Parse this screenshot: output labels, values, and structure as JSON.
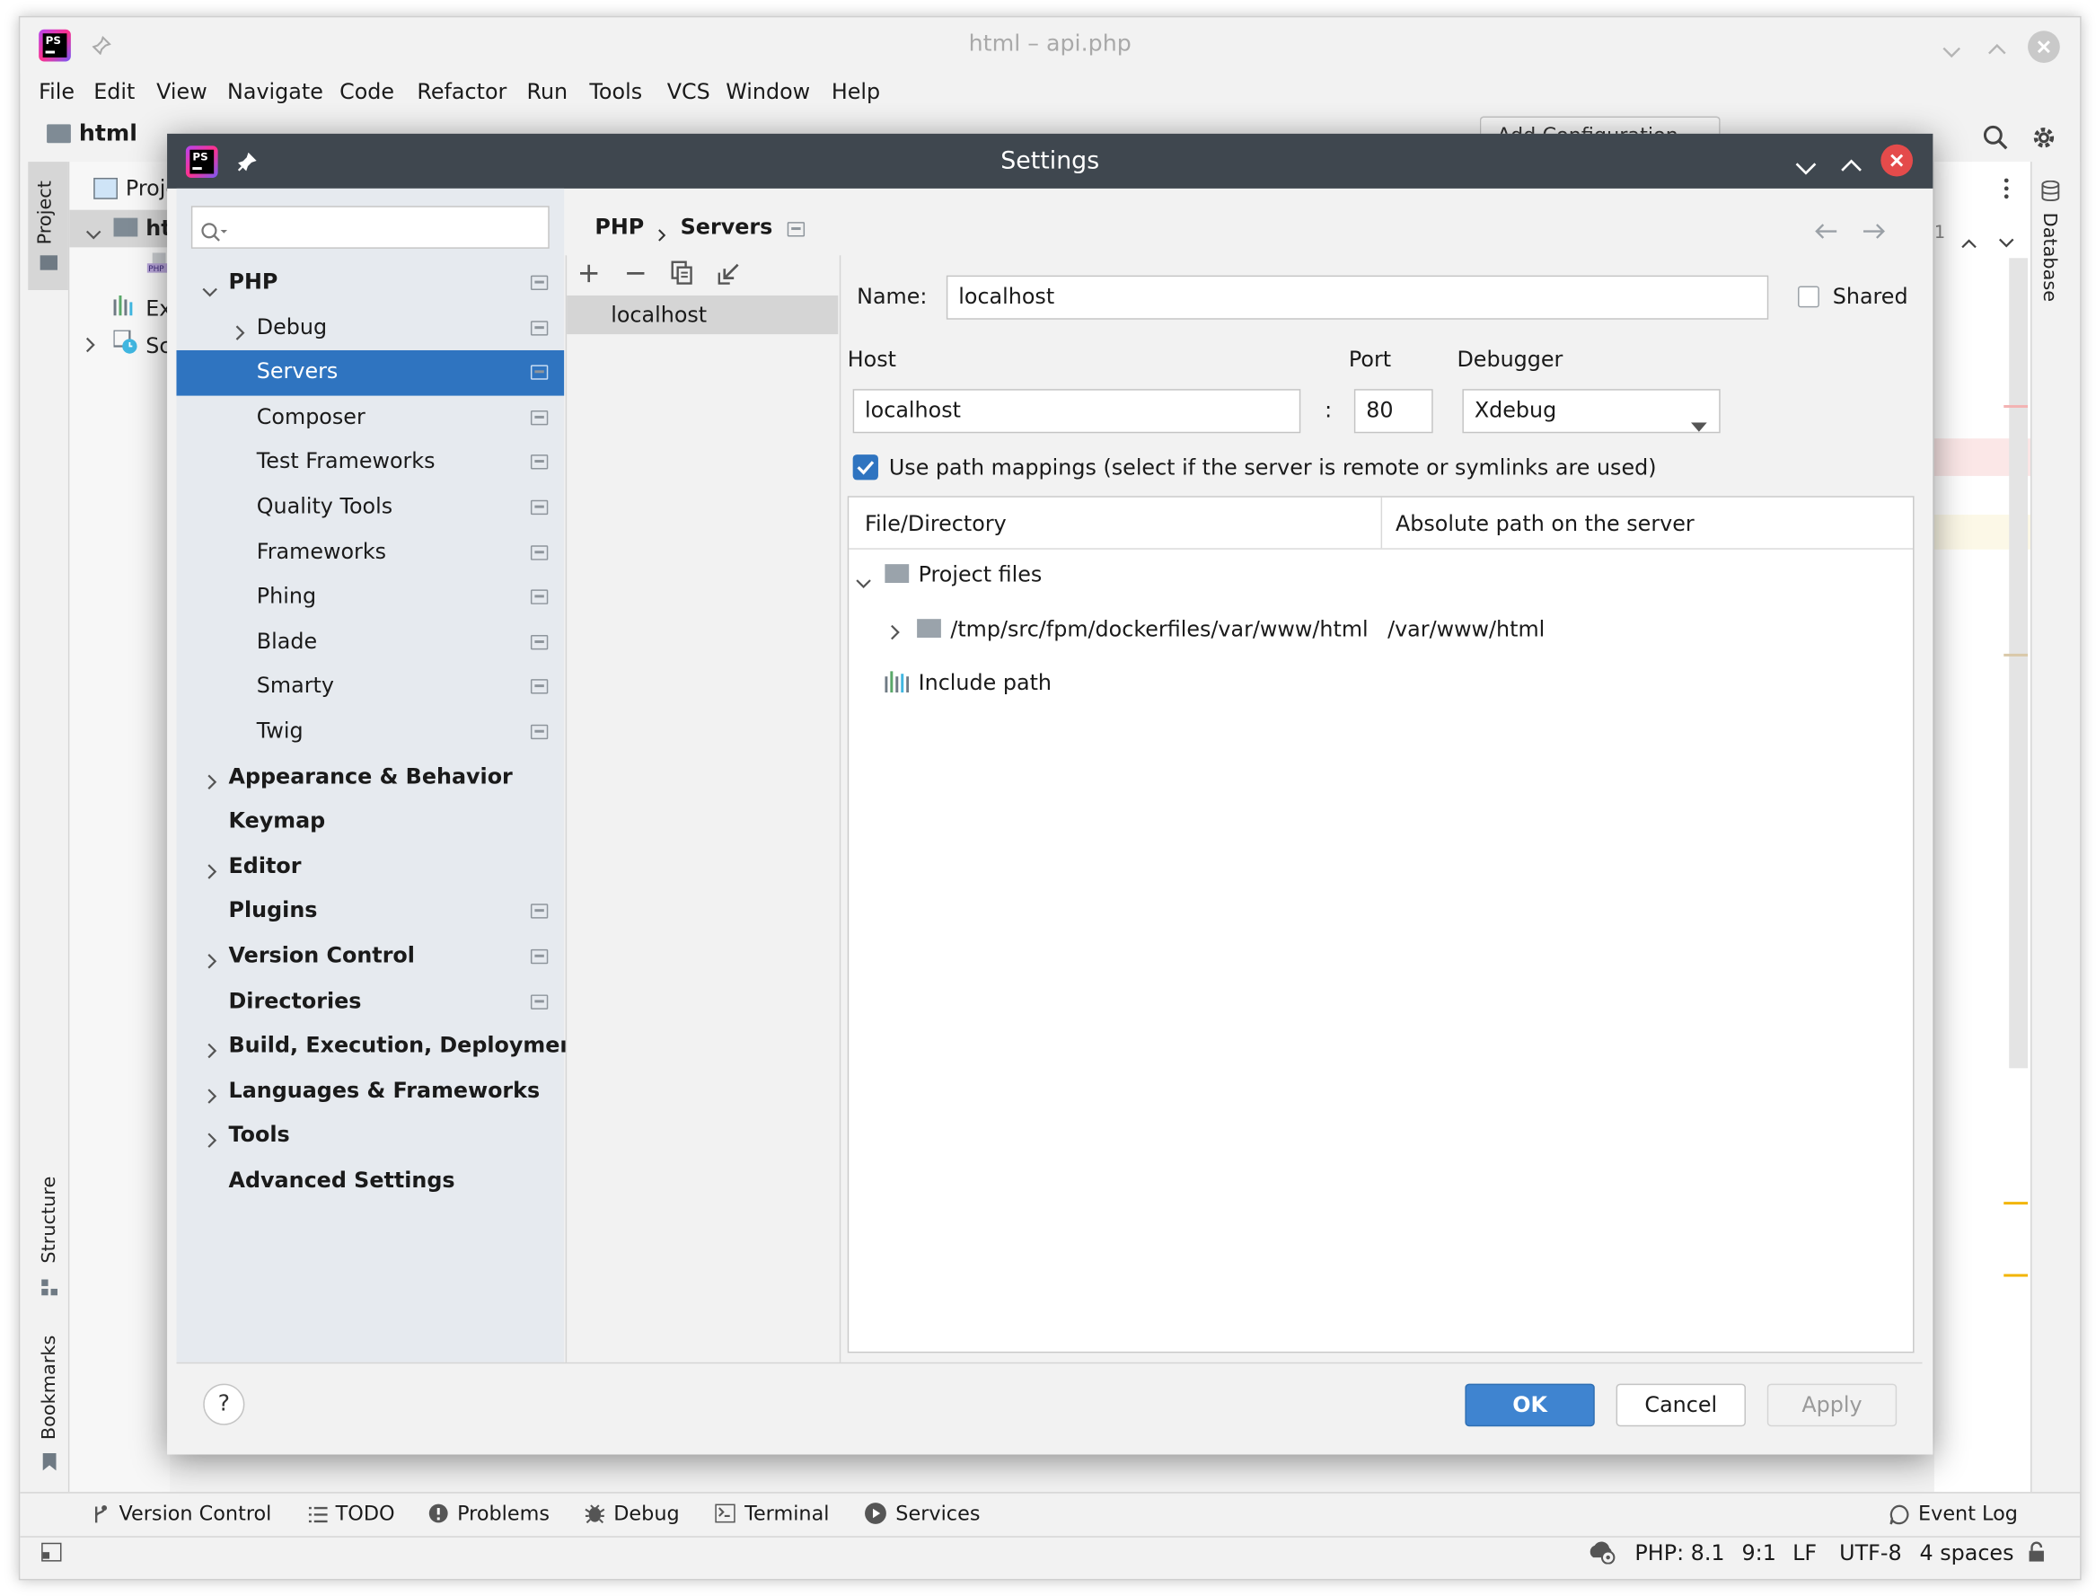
{
  "window": {
    "title": "html – api.php"
  },
  "menu": [
    "File",
    "Edit",
    "View",
    "Navigate",
    "Code",
    "Refactor",
    "Run",
    "Tools",
    "VCS",
    "Window",
    "Help"
  ],
  "navbar": {
    "project": "html",
    "run_config": "Add Configuration..."
  },
  "project_panel": {
    "header": "Proje",
    "rows": [
      "ht",
      "Ex",
      "Sc"
    ]
  },
  "left_tool_tabs": [
    "Project",
    "Structure",
    "Bookmarks"
  ],
  "right_tool_tabs": [
    "Database"
  ],
  "dialog": {
    "title": "Settings",
    "search": {
      "value": "",
      "placeholder": ""
    },
    "tree": [
      {
        "label": "PHP",
        "bold": true,
        "chevron": "down",
        "level": 0,
        "settings": true
      },
      {
        "label": "Debug",
        "bold": false,
        "chevron": "right",
        "level": 1,
        "settings": true
      },
      {
        "label": "Servers",
        "bold": false,
        "chevron": "",
        "level": 1,
        "settings": true,
        "selected": true
      },
      {
        "label": "Composer",
        "bold": false,
        "chevron": "",
        "level": 1,
        "settings": true
      },
      {
        "label": "Test Frameworks",
        "bold": false,
        "chevron": "",
        "level": 1,
        "settings": true
      },
      {
        "label": "Quality Tools",
        "bold": false,
        "chevron": "",
        "level": 1,
        "settings": true
      },
      {
        "label": "Frameworks",
        "bold": false,
        "chevron": "",
        "level": 1,
        "settings": true
      },
      {
        "label": "Phing",
        "bold": false,
        "chevron": "",
        "level": 1,
        "settings": true
      },
      {
        "label": "Blade",
        "bold": false,
        "chevron": "",
        "level": 1,
        "settings": true
      },
      {
        "label": "Smarty",
        "bold": false,
        "chevron": "",
        "level": 1,
        "settings": true
      },
      {
        "label": "Twig",
        "bold": false,
        "chevron": "",
        "level": 1,
        "settings": true
      },
      {
        "label": "Appearance & Behavior",
        "bold": true,
        "chevron": "right",
        "level": 0,
        "settings": false
      },
      {
        "label": "Keymap",
        "bold": true,
        "chevron": "",
        "level": 0,
        "settings": false
      },
      {
        "label": "Editor",
        "bold": true,
        "chevron": "right",
        "level": 0,
        "settings": false
      },
      {
        "label": "Plugins",
        "bold": true,
        "chevron": "",
        "level": 0,
        "settings": true
      },
      {
        "label": "Version Control",
        "bold": true,
        "chevron": "right",
        "level": 0,
        "settings": true
      },
      {
        "label": "Directories",
        "bold": true,
        "chevron": "",
        "level": 0,
        "settings": true
      },
      {
        "label": "Build, Execution, Deployment",
        "bold": true,
        "chevron": "right",
        "level": 0,
        "settings": false
      },
      {
        "label": "Languages & Frameworks",
        "bold": true,
        "chevron": "right",
        "level": 0,
        "settings": false
      },
      {
        "label": "Tools",
        "bold": true,
        "chevron": "right",
        "level": 0,
        "settings": false
      },
      {
        "label": "Advanced Settings",
        "bold": true,
        "chevron": "",
        "level": 0,
        "settings": false
      }
    ],
    "breadcrumb": [
      "PHP",
      "Servers"
    ],
    "servers": [
      "localhost"
    ],
    "form": {
      "name_label": "Name:",
      "name_value": "localhost",
      "shared_label": "Shared",
      "host_label": "Host",
      "host_value": "localhost",
      "colon": ":",
      "port_label": "Port",
      "port_value": "80",
      "debugger_label": "Debugger",
      "debugger_value": "Xdebug",
      "path_mappings_label": "Use path mappings (select if the server is remote or symlinks are used)",
      "path_mappings_checked": true
    },
    "mapping_table": {
      "columns": [
        "File/Directory",
        "Absolute path on the server"
      ],
      "project_files": "Project files",
      "row_local": "/tmp/src/fpm/dockerfiles/var/www/html",
      "row_remote": "/var/www/html",
      "include_path": "Include path"
    },
    "buttons": {
      "help": "?",
      "ok": "OK",
      "cancel": "Cancel",
      "apply": "Apply"
    },
    "accent": "#2f74c0"
  },
  "bottom_tabs": [
    "Version Control",
    "TODO",
    "Problems",
    "Debug",
    "Terminal",
    "Services"
  ],
  "event_log": "Event Log",
  "status_bar": [
    "PHP: 8.1",
    "9:1",
    "LF",
    "UTF-8",
    "4 spaces"
  ],
  "editor_gutter": {
    "line_hint": "1"
  }
}
